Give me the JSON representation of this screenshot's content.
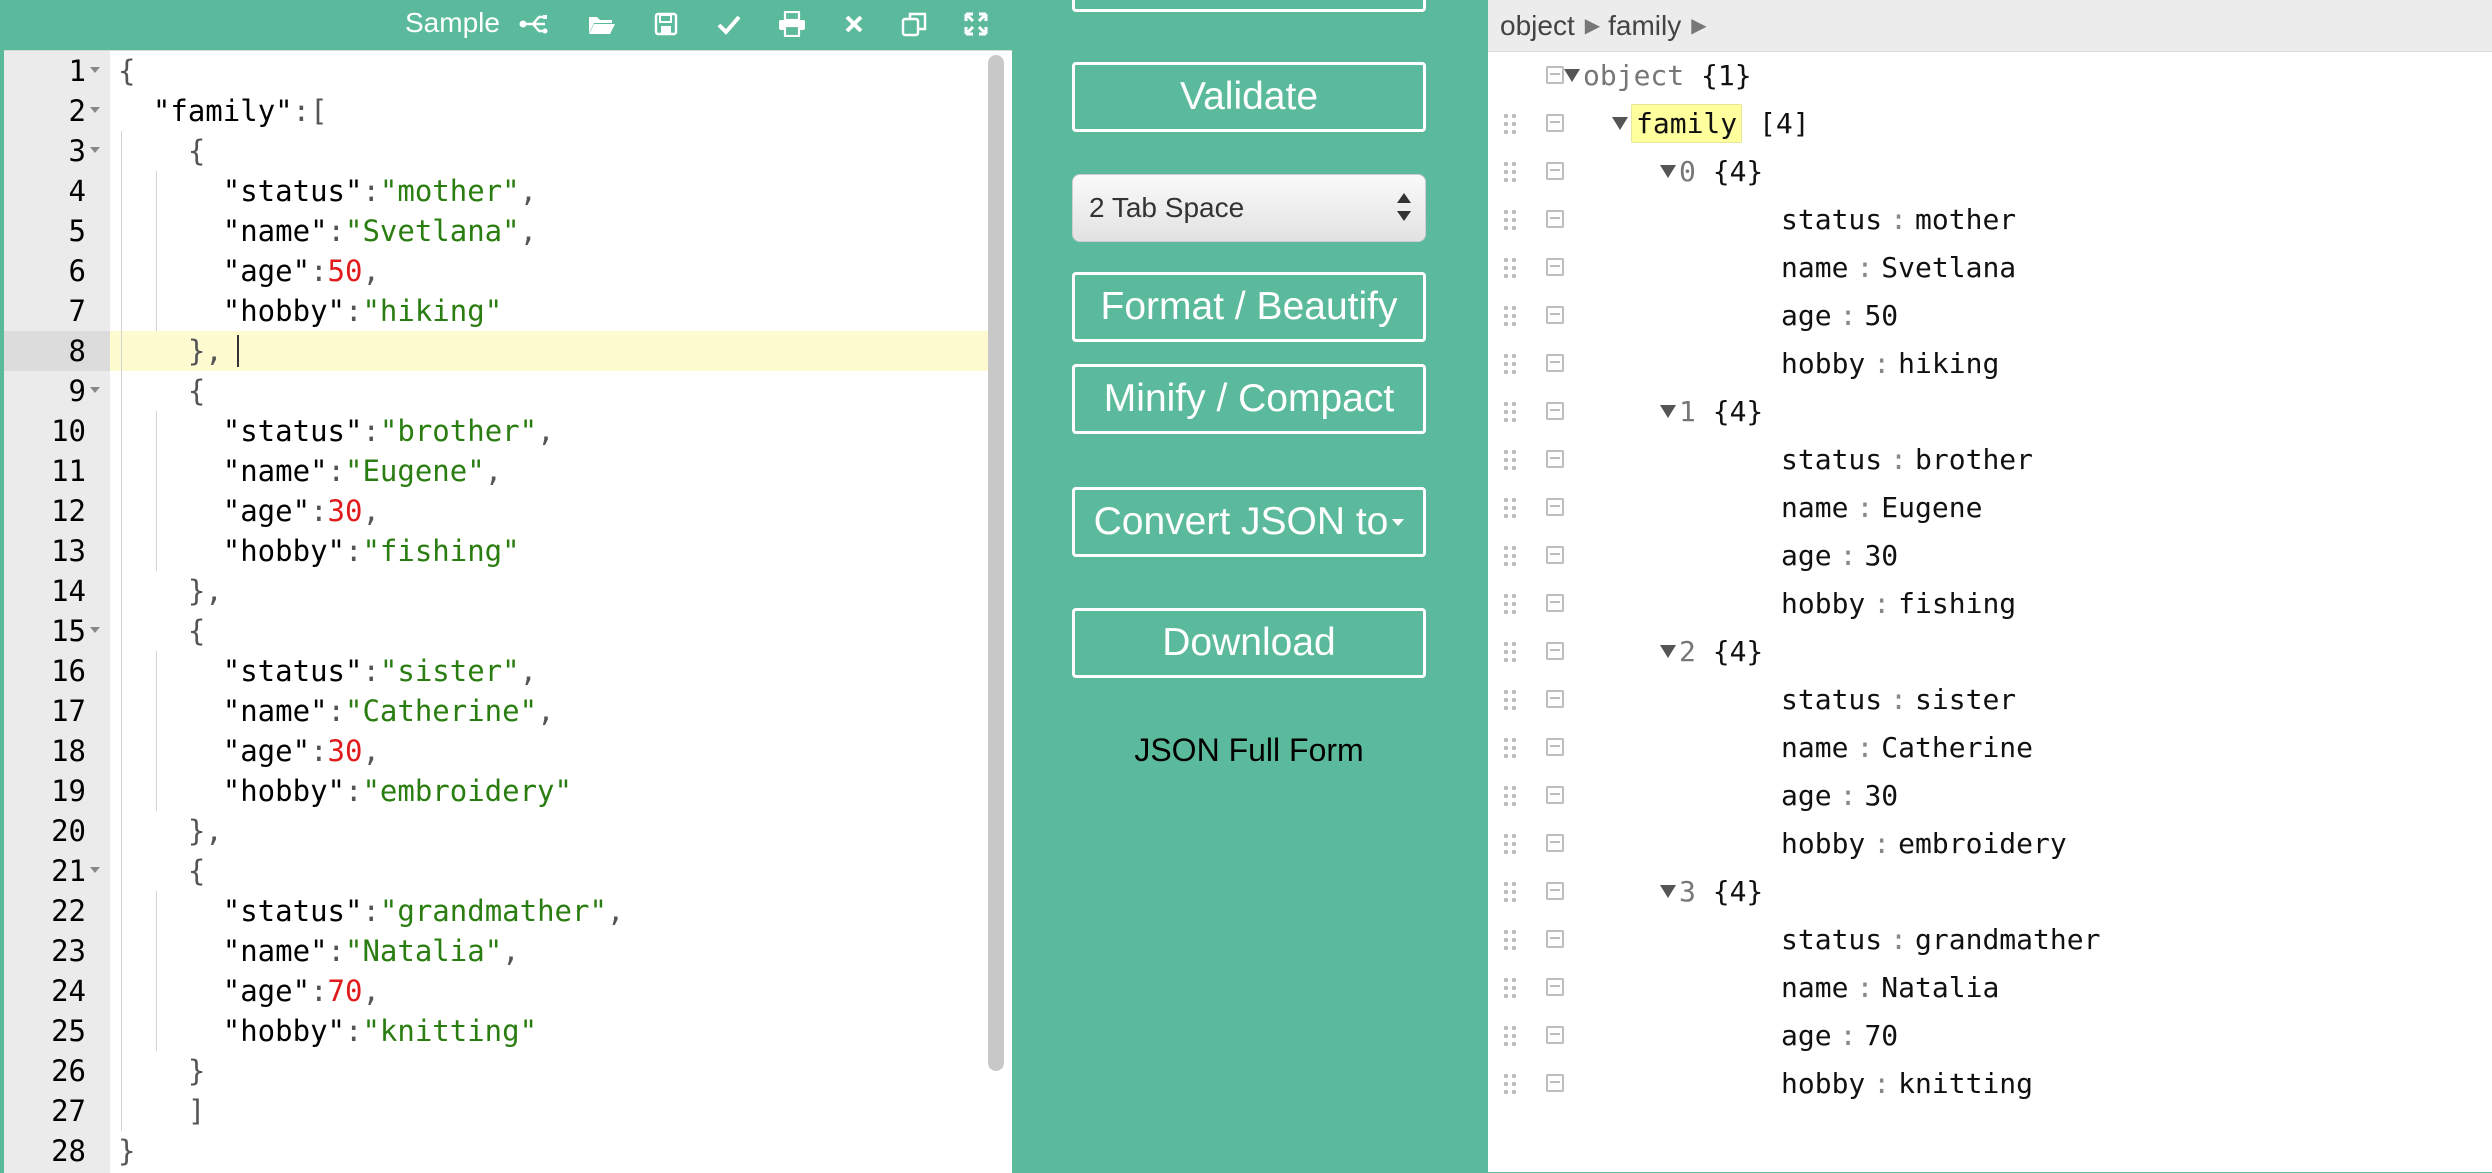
{
  "toolbar": {
    "title": "Sample",
    "icons": [
      "share-icon",
      "open-folder-icon",
      "save-icon",
      "check-icon",
      "print-icon",
      "clear-icon",
      "copy-icon",
      "fullscreen-icon"
    ]
  },
  "editor": {
    "line_numbers": [
      "1",
      "2",
      "3",
      "4",
      "5",
      "6",
      "7",
      "8",
      "9",
      "10",
      "11",
      "12",
      "13",
      "14",
      "15",
      "16",
      "17",
      "18",
      "19",
      "20",
      "21",
      "22",
      "23",
      "24",
      "25",
      "26",
      "27",
      "28"
    ],
    "active_line": 8
  },
  "controls": {
    "validate": "Validate",
    "tab_select": "2 Tab Space",
    "format": "Format / Beautify",
    "minify": "Minify / Compact",
    "convert": "Convert JSON to",
    "download": "Download",
    "full_form": "JSON Full Form"
  },
  "breadcrumb": [
    "object",
    "family"
  ],
  "tree": {
    "root": {
      "label": "object",
      "count": "{1}"
    },
    "family": {
      "label": "family",
      "count": "[4]"
    },
    "members": [
      {
        "index": "0",
        "count": "{4}",
        "status": "mother",
        "name": "Svetlana",
        "age": "50",
        "hobby": "hiking"
      },
      {
        "index": "1",
        "count": "{4}",
        "status": "brother",
        "name": "Eugene",
        "age": "30",
        "hobby": "fishing"
      },
      {
        "index": "2",
        "count": "{4}",
        "status": "sister",
        "name": "Catherine",
        "age": "30",
        "hobby": "embroidery"
      },
      {
        "index": "3",
        "count": "{4}",
        "status": "grandmather",
        "name": "Natalia",
        "age": "70",
        "hobby": "knitting"
      }
    ],
    "keys": {
      "status": "status",
      "name": "name",
      "age": "age",
      "hobby": "hobby"
    }
  },
  "colors": {
    "accent": "#5cba9c",
    "string": "#2a7d10",
    "number": "#e01b1b",
    "highlight": "#ffff9e"
  }
}
